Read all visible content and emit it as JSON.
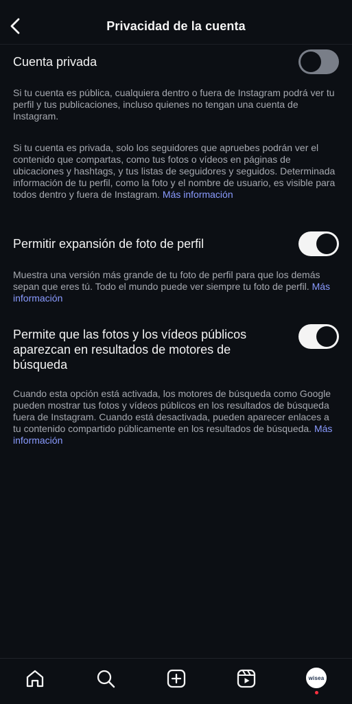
{
  "header": {
    "title": "Privacidad de la cuenta",
    "back_icon": "chevron-left-icon"
  },
  "settings": [
    {
      "label": "Cuenta privada",
      "enabled": false,
      "descriptions": [
        "Si tu cuenta es pública, cualquiera dentro o fuera de Instagram podrá ver tu perfil y tus publicaciones, incluso quienes no tengan una cuenta de Instagram.",
        "Si tu cuenta es privada, solo los seguidores que apruebes podrán ver el contenido que compartas, como tus fotos o vídeos en páginas de ubicaciones y hashtags, y tus listas de seguidores y seguidos. Determinada información de tu perfil, como la foto y el nombre de usuario, es visible para todos dentro y fuera de Instagram."
      ],
      "link": "Más información"
    },
    {
      "label": "Permitir expansión de foto de perfil",
      "enabled": true,
      "description": "Muestra una versión más grande de tu foto de perfil para que los demás sepan que eres tú. Todo el mundo puede ver siempre tu foto de perfil.",
      "link": "Más información"
    },
    {
      "label": "Permite que las fotos y los vídeos públicos aparezcan en resultados de motores de búsqueda",
      "enabled": true,
      "description": "Cuando esta opción está activada, los motores de búsqueda como Google pueden mostrar tus fotos y vídeos públicos en los resultados de búsqueda fuera de Instagram. Cuando está desactivada, pueden aparecer enlaces a tu contenido compartido públicamente en los resultados de búsqueda.",
      "link": "Más información"
    }
  ],
  "tabbar": {
    "icons": [
      "home-icon",
      "search-icon",
      "create-icon",
      "reels-icon"
    ],
    "avatar_text": "wisea",
    "notification_color": "#ff3040"
  },
  "colors": {
    "background": "#0c0f14",
    "link": "#8a9bff",
    "description": "#a6a9b0"
  }
}
